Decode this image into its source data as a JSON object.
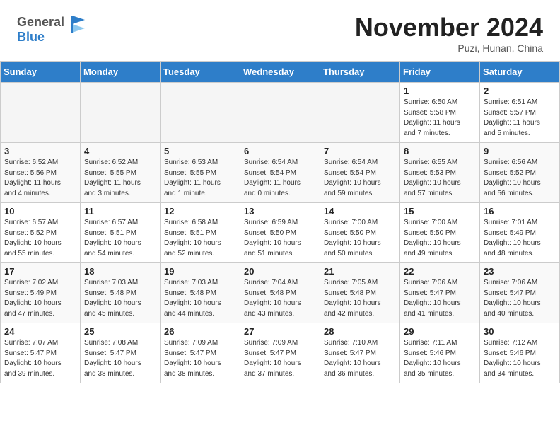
{
  "header": {
    "logo_line1": "General",
    "logo_line2": "Blue",
    "month": "November 2024",
    "location": "Puzi, Hunan, China"
  },
  "weekdays": [
    "Sunday",
    "Monday",
    "Tuesday",
    "Wednesday",
    "Thursday",
    "Friday",
    "Saturday"
  ],
  "weeks": [
    [
      {
        "day": "",
        "info": ""
      },
      {
        "day": "",
        "info": ""
      },
      {
        "day": "",
        "info": ""
      },
      {
        "day": "",
        "info": ""
      },
      {
        "day": "",
        "info": ""
      },
      {
        "day": "1",
        "info": "Sunrise: 6:50 AM\nSunset: 5:58 PM\nDaylight: 11 hours\nand 7 minutes."
      },
      {
        "day": "2",
        "info": "Sunrise: 6:51 AM\nSunset: 5:57 PM\nDaylight: 11 hours\nand 5 minutes."
      }
    ],
    [
      {
        "day": "3",
        "info": "Sunrise: 6:52 AM\nSunset: 5:56 PM\nDaylight: 11 hours\nand 4 minutes."
      },
      {
        "day": "4",
        "info": "Sunrise: 6:52 AM\nSunset: 5:55 PM\nDaylight: 11 hours\nand 3 minutes."
      },
      {
        "day": "5",
        "info": "Sunrise: 6:53 AM\nSunset: 5:55 PM\nDaylight: 11 hours\nand 1 minute."
      },
      {
        "day": "6",
        "info": "Sunrise: 6:54 AM\nSunset: 5:54 PM\nDaylight: 11 hours\nand 0 minutes."
      },
      {
        "day": "7",
        "info": "Sunrise: 6:54 AM\nSunset: 5:54 PM\nDaylight: 10 hours\nand 59 minutes."
      },
      {
        "day": "8",
        "info": "Sunrise: 6:55 AM\nSunset: 5:53 PM\nDaylight: 10 hours\nand 57 minutes."
      },
      {
        "day": "9",
        "info": "Sunrise: 6:56 AM\nSunset: 5:52 PM\nDaylight: 10 hours\nand 56 minutes."
      }
    ],
    [
      {
        "day": "10",
        "info": "Sunrise: 6:57 AM\nSunset: 5:52 PM\nDaylight: 10 hours\nand 55 minutes."
      },
      {
        "day": "11",
        "info": "Sunrise: 6:57 AM\nSunset: 5:51 PM\nDaylight: 10 hours\nand 54 minutes."
      },
      {
        "day": "12",
        "info": "Sunrise: 6:58 AM\nSunset: 5:51 PM\nDaylight: 10 hours\nand 52 minutes."
      },
      {
        "day": "13",
        "info": "Sunrise: 6:59 AM\nSunset: 5:50 PM\nDaylight: 10 hours\nand 51 minutes."
      },
      {
        "day": "14",
        "info": "Sunrise: 7:00 AM\nSunset: 5:50 PM\nDaylight: 10 hours\nand 50 minutes."
      },
      {
        "day": "15",
        "info": "Sunrise: 7:00 AM\nSunset: 5:50 PM\nDaylight: 10 hours\nand 49 minutes."
      },
      {
        "day": "16",
        "info": "Sunrise: 7:01 AM\nSunset: 5:49 PM\nDaylight: 10 hours\nand 48 minutes."
      }
    ],
    [
      {
        "day": "17",
        "info": "Sunrise: 7:02 AM\nSunset: 5:49 PM\nDaylight: 10 hours\nand 47 minutes."
      },
      {
        "day": "18",
        "info": "Sunrise: 7:03 AM\nSunset: 5:48 PM\nDaylight: 10 hours\nand 45 minutes."
      },
      {
        "day": "19",
        "info": "Sunrise: 7:03 AM\nSunset: 5:48 PM\nDaylight: 10 hours\nand 44 minutes."
      },
      {
        "day": "20",
        "info": "Sunrise: 7:04 AM\nSunset: 5:48 PM\nDaylight: 10 hours\nand 43 minutes."
      },
      {
        "day": "21",
        "info": "Sunrise: 7:05 AM\nSunset: 5:48 PM\nDaylight: 10 hours\nand 42 minutes."
      },
      {
        "day": "22",
        "info": "Sunrise: 7:06 AM\nSunset: 5:47 PM\nDaylight: 10 hours\nand 41 minutes."
      },
      {
        "day": "23",
        "info": "Sunrise: 7:06 AM\nSunset: 5:47 PM\nDaylight: 10 hours\nand 40 minutes."
      }
    ],
    [
      {
        "day": "24",
        "info": "Sunrise: 7:07 AM\nSunset: 5:47 PM\nDaylight: 10 hours\nand 39 minutes."
      },
      {
        "day": "25",
        "info": "Sunrise: 7:08 AM\nSunset: 5:47 PM\nDaylight: 10 hours\nand 38 minutes."
      },
      {
        "day": "26",
        "info": "Sunrise: 7:09 AM\nSunset: 5:47 PM\nDaylight: 10 hours\nand 38 minutes."
      },
      {
        "day": "27",
        "info": "Sunrise: 7:09 AM\nSunset: 5:47 PM\nDaylight: 10 hours\nand 37 minutes."
      },
      {
        "day": "28",
        "info": "Sunrise: 7:10 AM\nSunset: 5:47 PM\nDaylight: 10 hours\nand 36 minutes."
      },
      {
        "day": "29",
        "info": "Sunrise: 7:11 AM\nSunset: 5:46 PM\nDaylight: 10 hours\nand 35 minutes."
      },
      {
        "day": "30",
        "info": "Sunrise: 7:12 AM\nSunset: 5:46 PM\nDaylight: 10 hours\nand 34 minutes."
      }
    ]
  ]
}
